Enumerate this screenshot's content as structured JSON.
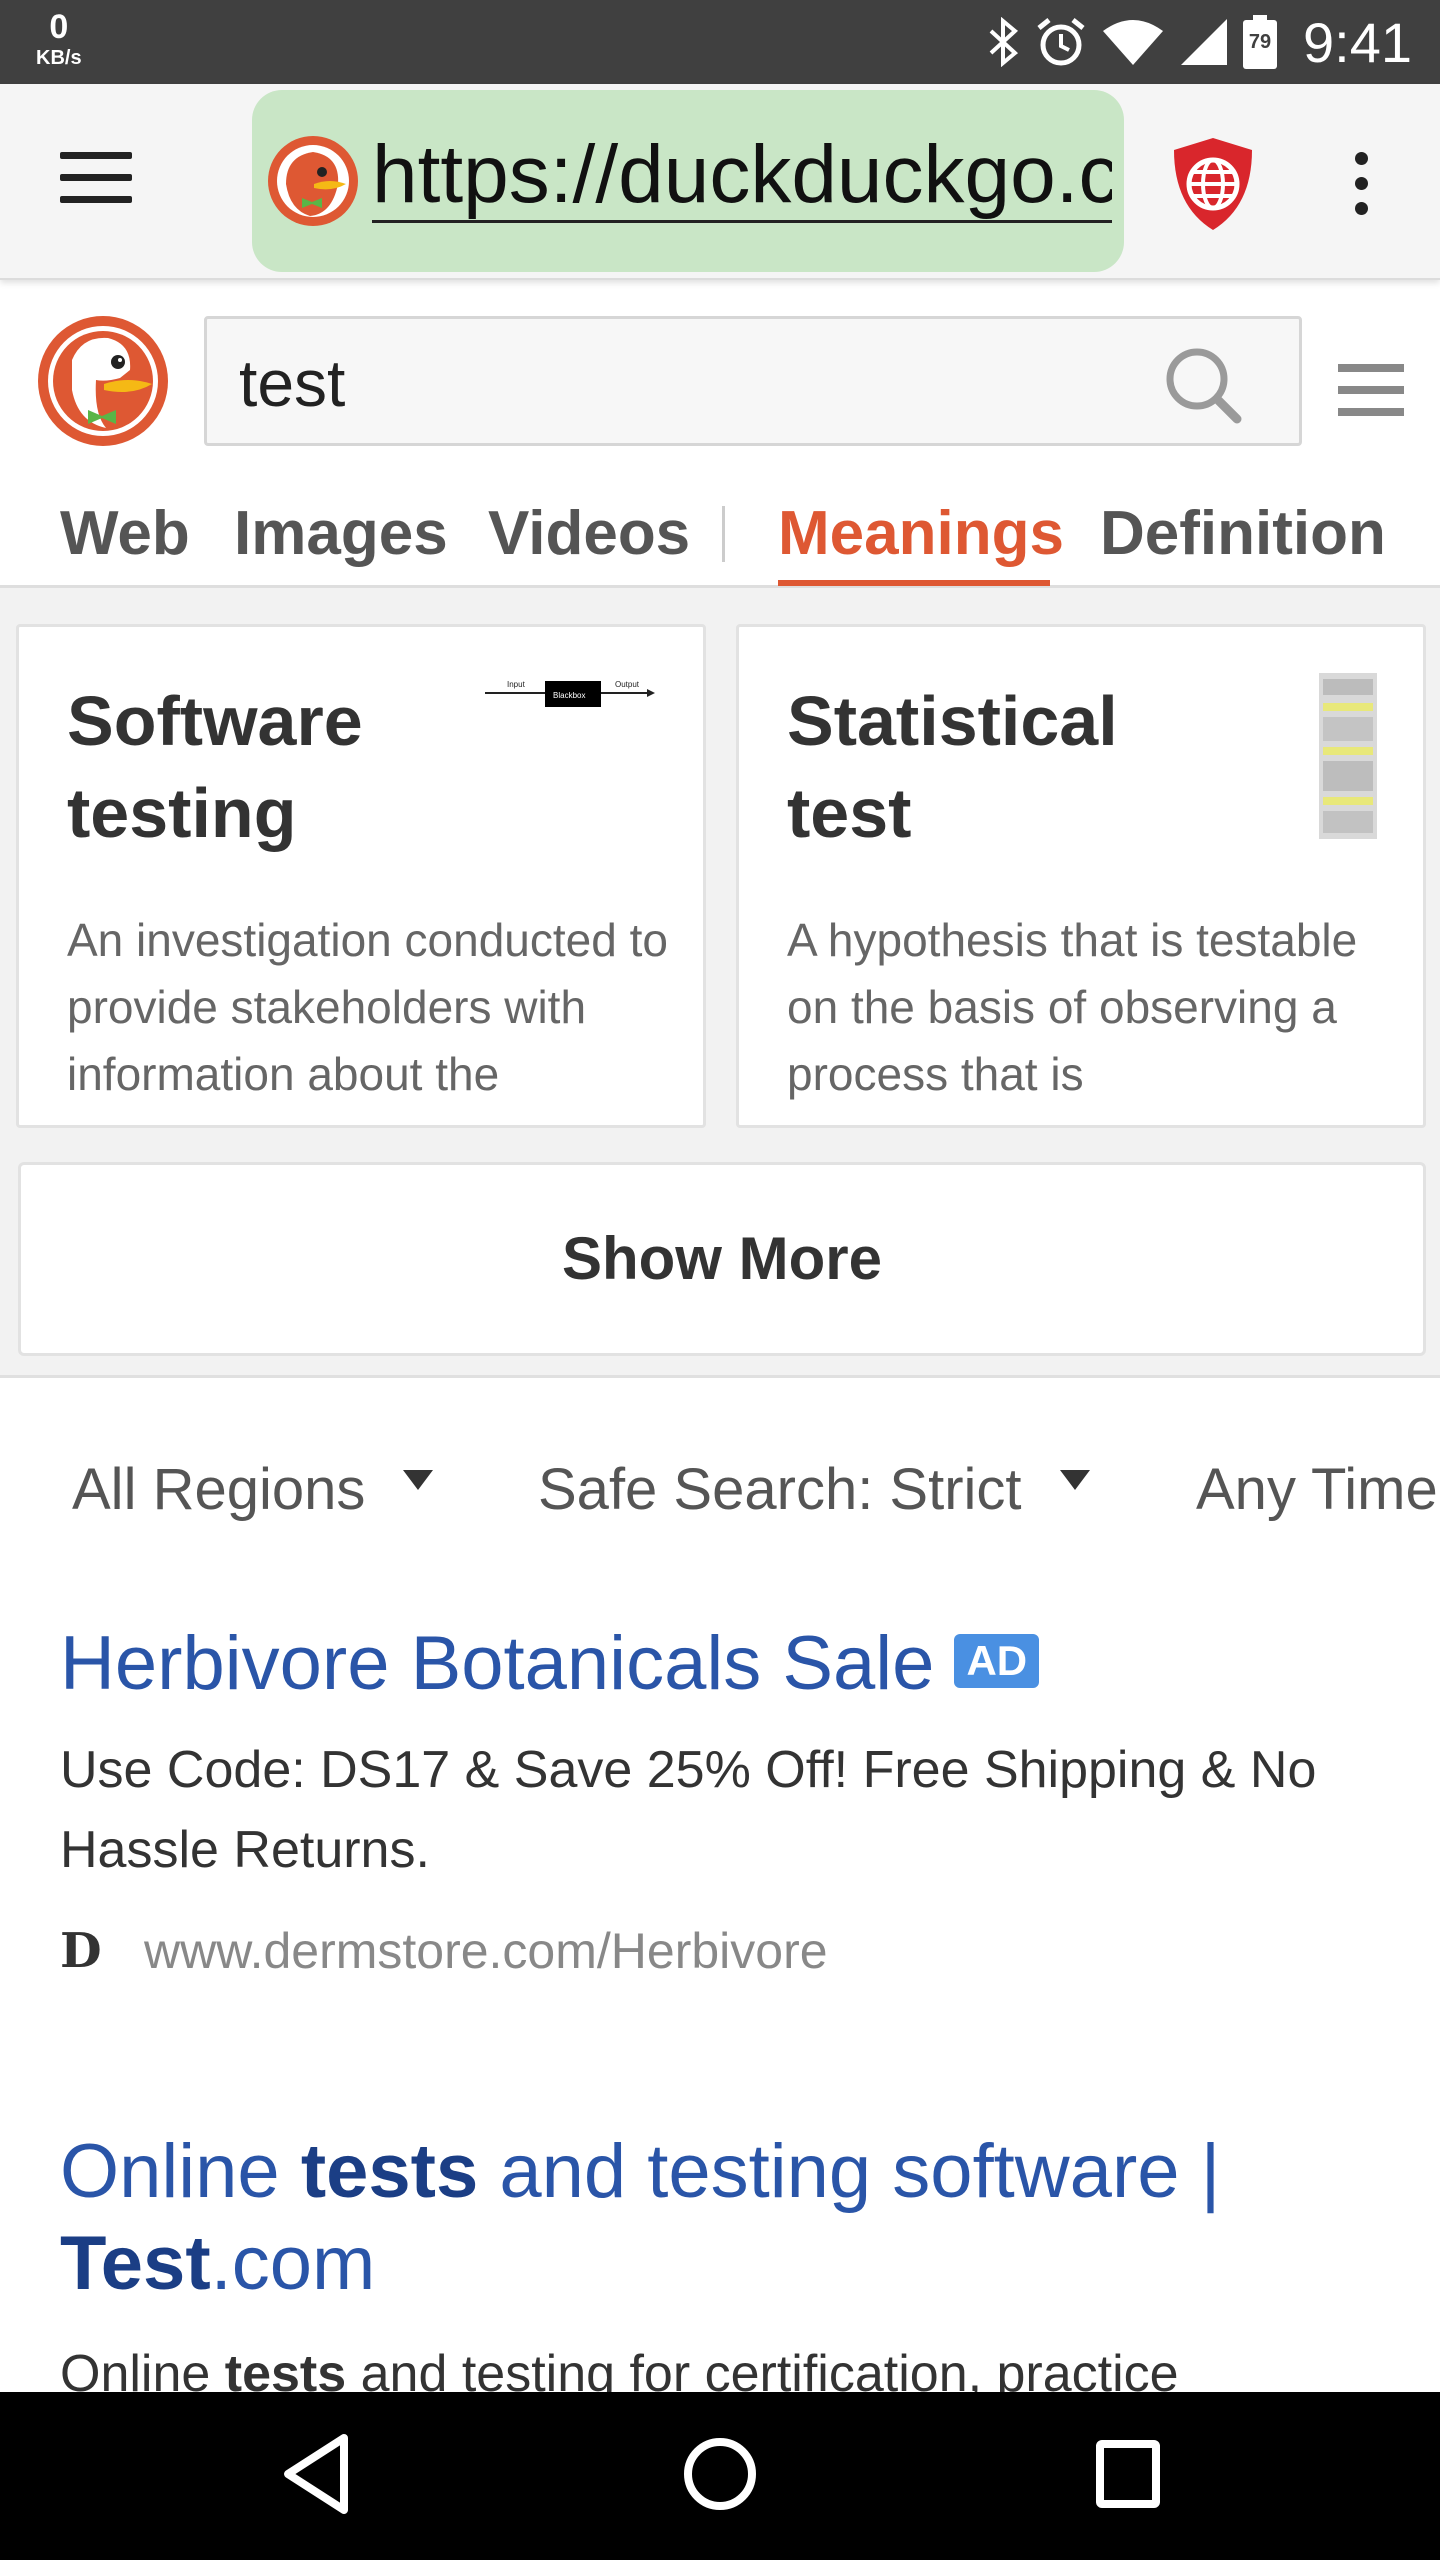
{
  "status_bar": {
    "net_speed": "0",
    "net_unit": "KB/s",
    "battery": "79",
    "time": "9:41"
  },
  "browser": {
    "url": "https://duckduckgo.com/?q=test",
    "menu_icon": "hamburger-menu-icon",
    "privacy_icon": "shield-globe-icon",
    "overflow_icon": "kebab-menu-icon"
  },
  "search": {
    "query": "test",
    "search_icon": "magnifier-icon"
  },
  "tabs": [
    {
      "label": "Web"
    },
    {
      "label": "Images"
    },
    {
      "label": "Videos"
    },
    {
      "label": "Meanings"
    },
    {
      "label": "Definition"
    }
  ],
  "active_tab": "Meanings",
  "meanings": {
    "cards": [
      {
        "title": "Software testing",
        "description": "An investigation conducted to provide stakeholders with information about the",
        "diagram_labels": [
          "Input",
          "Blackbox",
          "Output"
        ]
      },
      {
        "title": "Statistical test",
        "description": "A hypothesis that is testable on the basis of observing a process that is"
      }
    ],
    "show_more_label": "Show More"
  },
  "filters": {
    "region": "All Regions",
    "safe_search": "Safe Search: Strict",
    "time": "Any Time"
  },
  "results": [
    {
      "title": "Herbivore Botanicals Sale",
      "ad_badge": "AD",
      "snippet": "Use Code: DS17 & Save 25% Off! Free Shipping & No Hassle Returns.",
      "favicon_letter": "D",
      "url": "www.dermstore.com/Herbivore"
    },
    {
      "title_parts": [
        "Online ",
        "tests",
        " and testing software | ",
        "Test",
        ".com"
      ],
      "snippet_parts": [
        "Online ",
        "tests",
        " and testing for certification, practice"
      ]
    }
  ],
  "colors": {
    "accent": "#de5833",
    "link": "#2a55a8",
    "url_bar": "#c9e6c6",
    "ad_badge": "#4a90e2"
  }
}
